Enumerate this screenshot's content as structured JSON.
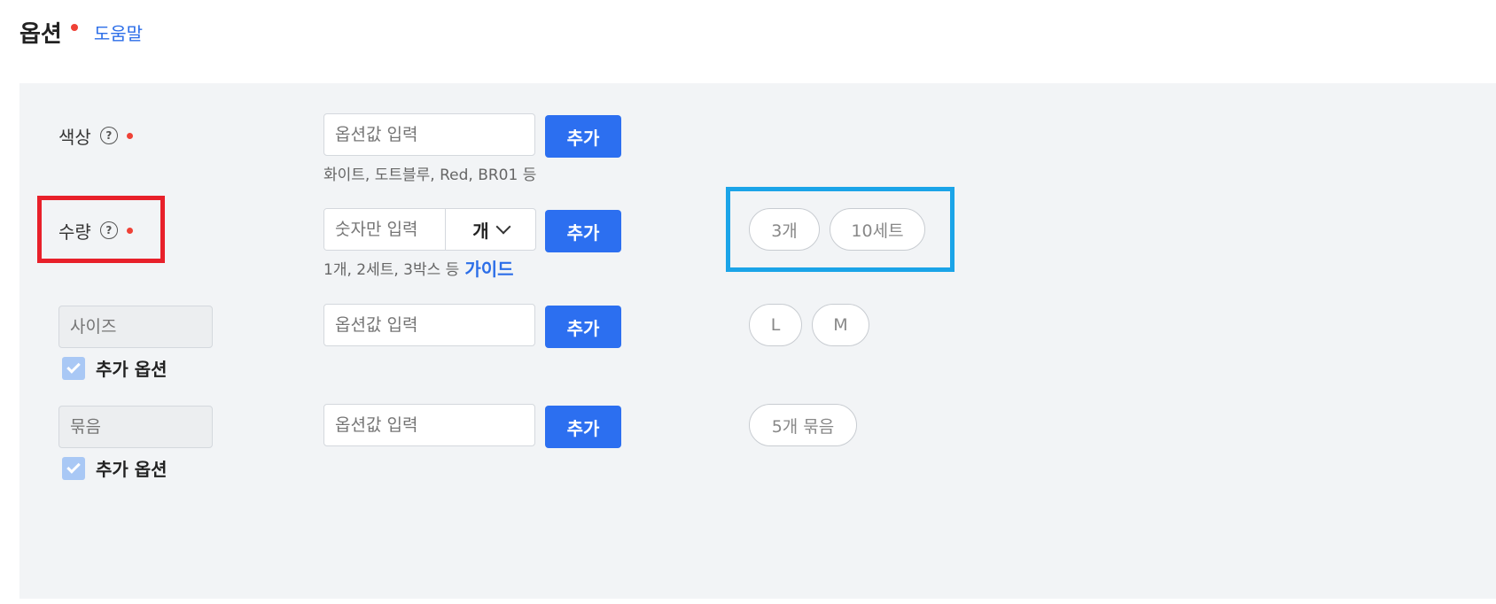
{
  "header": {
    "title": "옵션",
    "help_link": "도움말"
  },
  "colors": {
    "accent": "#2c6ff0",
    "required_dot": "#ef4136",
    "highlight_red": "#e8202a",
    "highlight_blue": "#1ba4e8"
  },
  "rows": {
    "color": {
      "label": "색상",
      "help_icon": "?",
      "input_placeholder": "옵션값 입력",
      "add_label": "추가",
      "hint": "화이트, 도트블루, Red, BR01 등"
    },
    "quantity": {
      "label": "수량",
      "help_icon": "?",
      "input_placeholder": "숫자만 입력",
      "unit": "개",
      "add_label": "추가",
      "hint": "1개, 2세트, 3박스 등",
      "guide_link": "가이드",
      "chips": [
        "3개",
        "10세트"
      ]
    },
    "size": {
      "name_placeholder": "사이즈",
      "input_placeholder": "옵션값 입력",
      "add_label": "추가",
      "checkbox_label": "추가 옵션",
      "checked": true,
      "chips": [
        "L",
        "M"
      ]
    },
    "bundle": {
      "name_placeholder": "묶음",
      "input_placeholder": "옵션값 입력",
      "add_label": "추가",
      "checkbox_label": "추가 옵션",
      "checked": true,
      "chips": [
        "5개 묶음"
      ]
    }
  }
}
